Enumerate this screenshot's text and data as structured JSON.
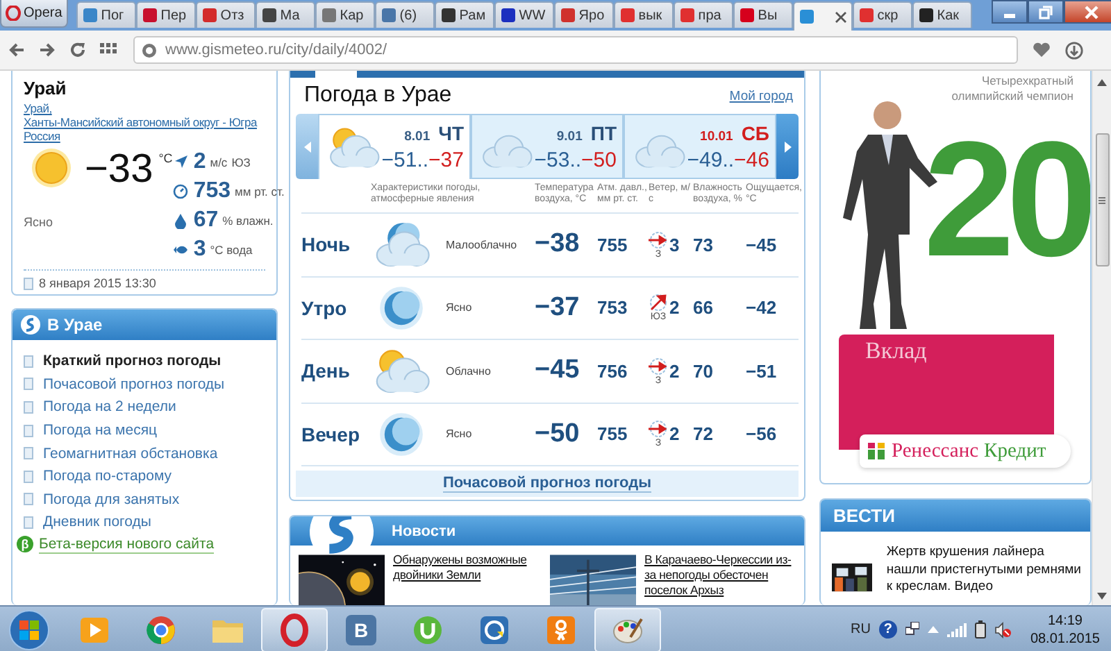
{
  "browser": {
    "menu_label": "Opera",
    "tabs": [
      {
        "label": "Пог",
        "selected": false
      },
      {
        "label": "Пер",
        "selected": false
      },
      {
        "label": "Отз",
        "selected": false
      },
      {
        "label": "Ма",
        "selected": false
      },
      {
        "label": "Кар",
        "selected": false
      },
      {
        "label": "(6)",
        "selected": false
      },
      {
        "label": "Рам",
        "selected": false
      },
      {
        "label": "WW",
        "selected": false
      },
      {
        "label": "Яро",
        "selected": false
      },
      {
        "label": "вык",
        "selected": false
      },
      {
        "label": "пра",
        "selected": false
      },
      {
        "label": "Вы",
        "selected": false
      },
      {
        "selected": true
      },
      {
        "label": "скр",
        "selected": false
      },
      {
        "label": "Как",
        "selected": false
      }
    ],
    "url": "www.gismeteo.ru/city/daily/4002/"
  },
  "current": {
    "city": "Урай",
    "location_links": [
      "Урай,",
      "Ханты-Мансийский автономный округ - Югра",
      "Россия"
    ],
    "temp": "−33",
    "unit": "°C",
    "condition": "Ясно",
    "stats": [
      {
        "kind": "wind",
        "value": "2",
        "unit": "м/с",
        "extra": "ЮЗ"
      },
      {
        "kind": "pressure",
        "value": "753",
        "unit": "мм рт. ст."
      },
      {
        "kind": "humidity",
        "value": "67",
        "unit": "% влажн."
      },
      {
        "kind": "water",
        "value": "3",
        "unit": "°С вода"
      }
    ],
    "updated": "8 января 2015 13:30"
  },
  "city_menu": {
    "title": "В Урае",
    "items": [
      {
        "label": "Краткий прогноз погоды",
        "selected": true
      },
      {
        "label": "Почасовой прогноз погоды",
        "selected": false
      },
      {
        "label": "Погода на 2 недели",
        "selected": false
      },
      {
        "label": "Погода на месяц",
        "selected": false
      },
      {
        "label": "Геомагнитная обстановка",
        "selected": false
      },
      {
        "label": "Погода по-старому",
        "selected": false
      },
      {
        "label": "Погода для занятых",
        "selected": false
      },
      {
        "label": "Дневник погоды",
        "selected": false
      }
    ],
    "beta_badge": "β",
    "beta_link": "Бета-версия нового сайта"
  },
  "forecast": {
    "title": "Погода в Урае",
    "my_city": "Мой город",
    "days": [
      {
        "date": "8.01",
        "weekday": "ЧТ",
        "min": "−51..",
        "max": "−37",
        "kind": "cloud-sun",
        "selected": true,
        "weekend": false
      },
      {
        "date": "9.01",
        "weekday": "ПТ",
        "min": "−53..",
        "max": "−50",
        "kind": "cloud",
        "selected": false,
        "weekend": false
      },
      {
        "date": "10.01",
        "weekday": "СБ",
        "min": "−49..",
        "max": "−46",
        "kind": "cloud",
        "selected": false,
        "weekend": true
      }
    ],
    "headers": [
      "Характеристики погоды, атмосферные явления",
      "Температура воздуха, °C",
      "Атм. давл., мм рт. ст.",
      "Ветер, м/с",
      "Влажность воздуха, %",
      "Ощущается, °C"
    ],
    "rows": [
      {
        "period": "Ночь",
        "kind": "moon-cloud",
        "condition": "Малооблачно",
        "temp": "−38",
        "pressure": "755",
        "wind": {
          "kind": "east",
          "speed": "3",
          "direction": "З"
        },
        "humidity": "73",
        "feels": "−45"
      },
      {
        "period": "Утро",
        "kind": "moon",
        "condition": "Ясно",
        "temp": "−37",
        "pressure": "753",
        "wind": {
          "kind": "northeast",
          "speed": "2",
          "direction": "ЮЗ"
        },
        "humidity": "66",
        "feels": "−42"
      },
      {
        "period": "День",
        "kind": "cloud-sun",
        "condition": "Облачно",
        "temp": "−45",
        "pressure": "756",
        "wind": {
          "kind": "east",
          "speed": "2",
          "direction": "З"
        },
        "humidity": "70",
        "feels": "−51"
      },
      {
        "period": "Вечер",
        "kind": "moon",
        "condition": "Ясно",
        "temp": "−50",
        "pressure": "755",
        "wind": {
          "kind": "east",
          "speed": "2",
          "direction": "З"
        },
        "humidity": "72",
        "feels": "−56"
      }
    ],
    "hourly_link": "Почасовой прогноз погоды"
  },
  "news": {
    "title": "Новости",
    "items": [
      {
        "text": "Обнаружены возможные двойники Земли",
        "kind": "space"
      },
      {
        "text": "В Карачаево-Черкессии из-за непогоды обесточен поселок Архыз",
        "kind": "wires"
      }
    ]
  },
  "ad": {
    "lines": [
      "Четырехкратный",
      "олимпийский чемпион"
    ],
    "big_number": "20",
    "product": "Вклад",
    "brand": [
      "Ренессанс",
      "Кредит"
    ]
  },
  "vesti": {
    "title": "ВЕСТИ",
    "items": [
      {
        "text": "Жертв крушения лайнера нашли пристегнутыми ремнями к креслам. Видео"
      }
    ]
  },
  "taskbar": {
    "apps": [
      {
        "kind": "media",
        "open": false
      },
      {
        "kind": "browser",
        "open": false
      },
      {
        "kind": "folder",
        "open": false
      },
      {
        "kind": "opera",
        "open": true
      },
      {
        "kind": "letter",
        "glyph": "В",
        "open": false
      },
      {
        "kind": "torrent",
        "open": false
      },
      {
        "kind": "shield",
        "open": false
      },
      {
        "kind": "ok",
        "open": false
      },
      {
        "kind": "paint",
        "open": true
      }
    ],
    "lang": "RU",
    "help_glyph": "?",
    "time": "14:19",
    "date": "08.01.2015"
  }
}
